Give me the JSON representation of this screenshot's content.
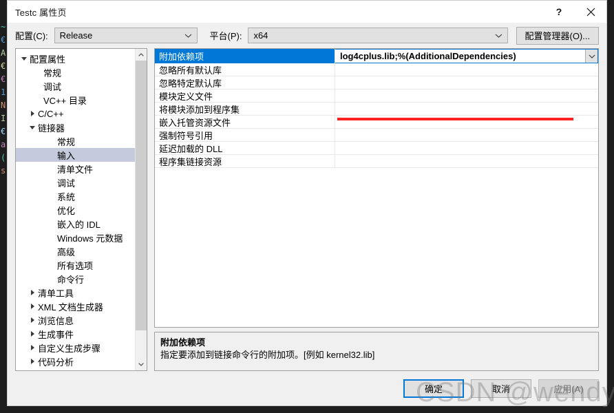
{
  "window": {
    "title": "Testc 属性页",
    "help_icon": "question-mark-icon",
    "close_icon": "close-icon"
  },
  "config_bar": {
    "config_label": "配置(C):",
    "config_value": "Release",
    "platform_label": "平台(P):",
    "platform_value": "x64",
    "config_manager_button": "配置管理器(O)..."
  },
  "tree": {
    "items": [
      {
        "label": "配置属性",
        "level": 0,
        "twisty": "down",
        "selected": false
      },
      {
        "label": "常规",
        "level": 1,
        "twisty": "none",
        "selected": false
      },
      {
        "label": "调试",
        "level": 1,
        "twisty": "none",
        "selected": false
      },
      {
        "label": "VC++ 目录",
        "level": 1,
        "twisty": "none",
        "selected": false
      },
      {
        "label": "C/C++",
        "level": 0,
        "twisty": "right",
        "selected": false,
        "indent": 1
      },
      {
        "label": "链接器",
        "level": 0,
        "twisty": "down",
        "selected": false,
        "indent": 1
      },
      {
        "label": "常规",
        "level": 2,
        "twisty": "none",
        "selected": false
      },
      {
        "label": "输入",
        "level": 2,
        "twisty": "none",
        "selected": true
      },
      {
        "label": "清单文件",
        "level": 2,
        "twisty": "none",
        "selected": false
      },
      {
        "label": "调试",
        "level": 2,
        "twisty": "none",
        "selected": false
      },
      {
        "label": "系统",
        "level": 2,
        "twisty": "none",
        "selected": false
      },
      {
        "label": "优化",
        "level": 2,
        "twisty": "none",
        "selected": false
      },
      {
        "label": "嵌入的 IDL",
        "level": 2,
        "twisty": "none",
        "selected": false
      },
      {
        "label": "Windows 元数据",
        "level": 2,
        "twisty": "none",
        "selected": false
      },
      {
        "label": "高级",
        "level": 2,
        "twisty": "none",
        "selected": false
      },
      {
        "label": "所有选项",
        "level": 2,
        "twisty": "none",
        "selected": false
      },
      {
        "label": "命令行",
        "level": 2,
        "twisty": "none",
        "selected": false
      },
      {
        "label": "清单工具",
        "level": 0,
        "twisty": "right",
        "selected": false,
        "indent": 1
      },
      {
        "label": "XML 文档生成器",
        "level": 0,
        "twisty": "right",
        "selected": false,
        "indent": 1
      },
      {
        "label": "浏览信息",
        "level": 0,
        "twisty": "right",
        "selected": false,
        "indent": 1
      },
      {
        "label": "生成事件",
        "level": 0,
        "twisty": "right",
        "selected": false,
        "indent": 1
      },
      {
        "label": "自定义生成步骤",
        "level": 0,
        "twisty": "right",
        "selected": false,
        "indent": 1
      },
      {
        "label": "代码分析",
        "level": 0,
        "twisty": "right",
        "selected": false,
        "indent": 1
      }
    ],
    "scrollbar": {
      "up_icon": "chevron-up-icon",
      "down_icon": "chevron-down-icon"
    }
  },
  "property_grid": {
    "rows": [
      {
        "name": "附加依赖项",
        "value": "log4cplus.lib;%(AdditionalDependencies)",
        "selected": true,
        "has_dropdown": true
      },
      {
        "name": "忽略所有默认库",
        "value": "",
        "selected": false,
        "has_dropdown": false
      },
      {
        "name": "忽略特定默认库",
        "value": "",
        "selected": false,
        "has_dropdown": false
      },
      {
        "name": "模块定义文件",
        "value": "",
        "selected": false,
        "has_dropdown": false
      },
      {
        "name": "将模块添加到程序集",
        "value": "",
        "selected": false,
        "has_dropdown": false
      },
      {
        "name": "嵌入托管资源文件",
        "value": "",
        "selected": false,
        "has_dropdown": false
      },
      {
        "name": "强制符号引用",
        "value": "",
        "selected": false,
        "has_dropdown": false
      },
      {
        "name": "延迟加载的 DLL",
        "value": "",
        "selected": false,
        "has_dropdown": false
      },
      {
        "name": "程序集链接资源",
        "value": "",
        "selected": false,
        "has_dropdown": false
      }
    ],
    "annotation_color": "#fd2222"
  },
  "description": {
    "title": "附加依赖项",
    "text": "指定要添加到链接命令行的附加项。[例如 kernel32.lib]"
  },
  "footer": {
    "ok": "确定",
    "cancel": "取消",
    "apply": "应用(A)"
  },
  "watermark": {
    "text": "CSDN @wendy_ya"
  },
  "background_editor": {
    "lines": [
      "~",
      "€",
      "",
      "A",
      "€",
      "",
      "€",
      "",
      "1",
      "N",
      "I",
      "",
      "€",
      "a",
      "(",
      "",
      "s"
    ]
  },
  "colors": {
    "accent": "#0078d7",
    "selection_tree": "#c5cbdc",
    "annotation": "#fd2222",
    "dialog_bg": "#f0f0f0"
  }
}
